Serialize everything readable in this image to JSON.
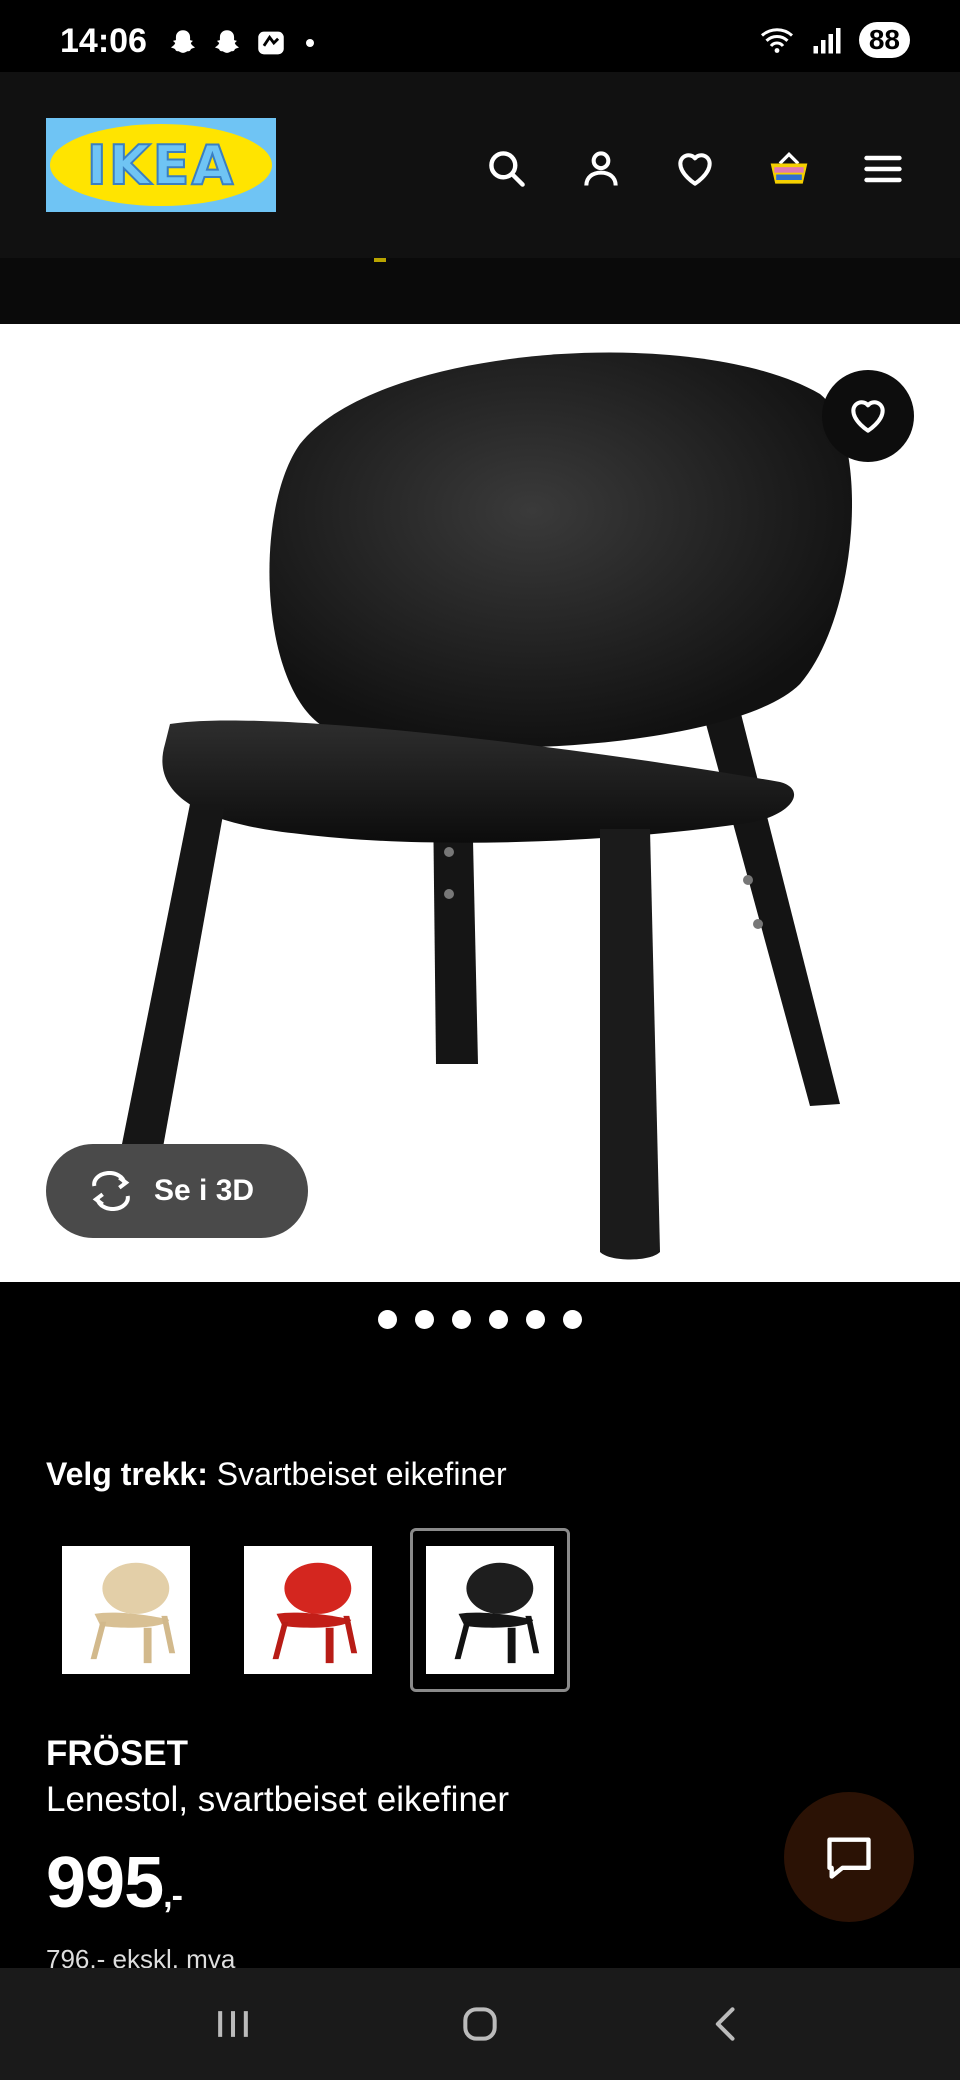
{
  "status_bar": {
    "time": "14:06",
    "battery": "88"
  },
  "header": {
    "logo_text": "IKEA",
    "icons": [
      "search-icon",
      "account-icon",
      "heart-icon",
      "basket-icon",
      "menu-icon"
    ]
  },
  "gallery": {
    "see_3d_label": "Se i 3D",
    "dots_count": 6
  },
  "variant": {
    "label": "Velg trekk:",
    "selected_value": "Svartbeiset eikefiner",
    "options": [
      "birch",
      "red",
      "black"
    ]
  },
  "product": {
    "name": "FRÖSET",
    "description": "Lenestol, svartbeiset eikefiner",
    "price": "995",
    "price_suffix": ",-",
    "price_ex_vat": "796,- ekskl. mva"
  },
  "colors": {
    "logo_blue": "#6fc4f4",
    "logo_yellow": "#ffe400",
    "chat_bg": "#2b1205"
  }
}
